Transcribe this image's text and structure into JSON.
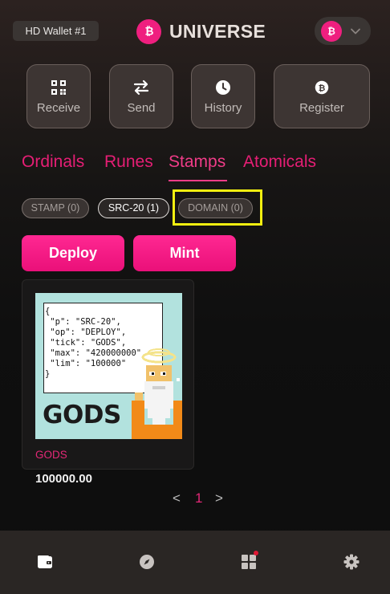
{
  "header": {
    "wallet_label": "HD Wallet #1",
    "brand_name": "UNIVERSE",
    "brand_icon": "bitcoin-icon",
    "chain_icon": "bitcoin-icon"
  },
  "actions": [
    {
      "label": "Receive",
      "icon": "qr-code-icon"
    },
    {
      "label": "Send",
      "icon": "transfer-arrows-icon"
    },
    {
      "label": "History",
      "icon": "clock-icon"
    },
    {
      "label": "Register",
      "icon": "bitcoin-icon"
    }
  ],
  "tabs": [
    {
      "label": "Ordinals",
      "active": false
    },
    {
      "label": "Runes",
      "active": false
    },
    {
      "label": "Stamps",
      "active": true
    },
    {
      "label": "Atomicals",
      "active": false
    }
  ],
  "filters": [
    {
      "label": "STAMP (0)",
      "active": false
    },
    {
      "label": "SRC-20 (1)",
      "active": true
    },
    {
      "label": "DOMAIN (0)",
      "active": false
    }
  ],
  "buttons": {
    "deploy": "Deploy",
    "mint": "Mint"
  },
  "token_card": {
    "image_json": "{\n \"p\": \"SRC-20\",\n \"op\": \"DEPLOY\",\n \"tick\": \"GODS\",\n \"max\": \"420000000\",\n \"lim\": \"100000\"\n}",
    "image_caption": "GODS",
    "ticker": "GODS",
    "amount": "100000.00"
  },
  "pagination": {
    "prev": "<",
    "current": "1",
    "next": ">"
  },
  "bottom_nav": [
    {
      "icon": "wallet-icon",
      "active": true
    },
    {
      "icon": "compass-icon",
      "active": false
    },
    {
      "icon": "apps-grid-icon",
      "active": false,
      "notification": true
    },
    {
      "icon": "settings-gear-icon",
      "active": false
    }
  ],
  "colors": {
    "accent": "#e61e75",
    "button_pink": "#f21685",
    "highlight": "#f2ee10",
    "bottom_nav_bg": "#2a2624"
  }
}
